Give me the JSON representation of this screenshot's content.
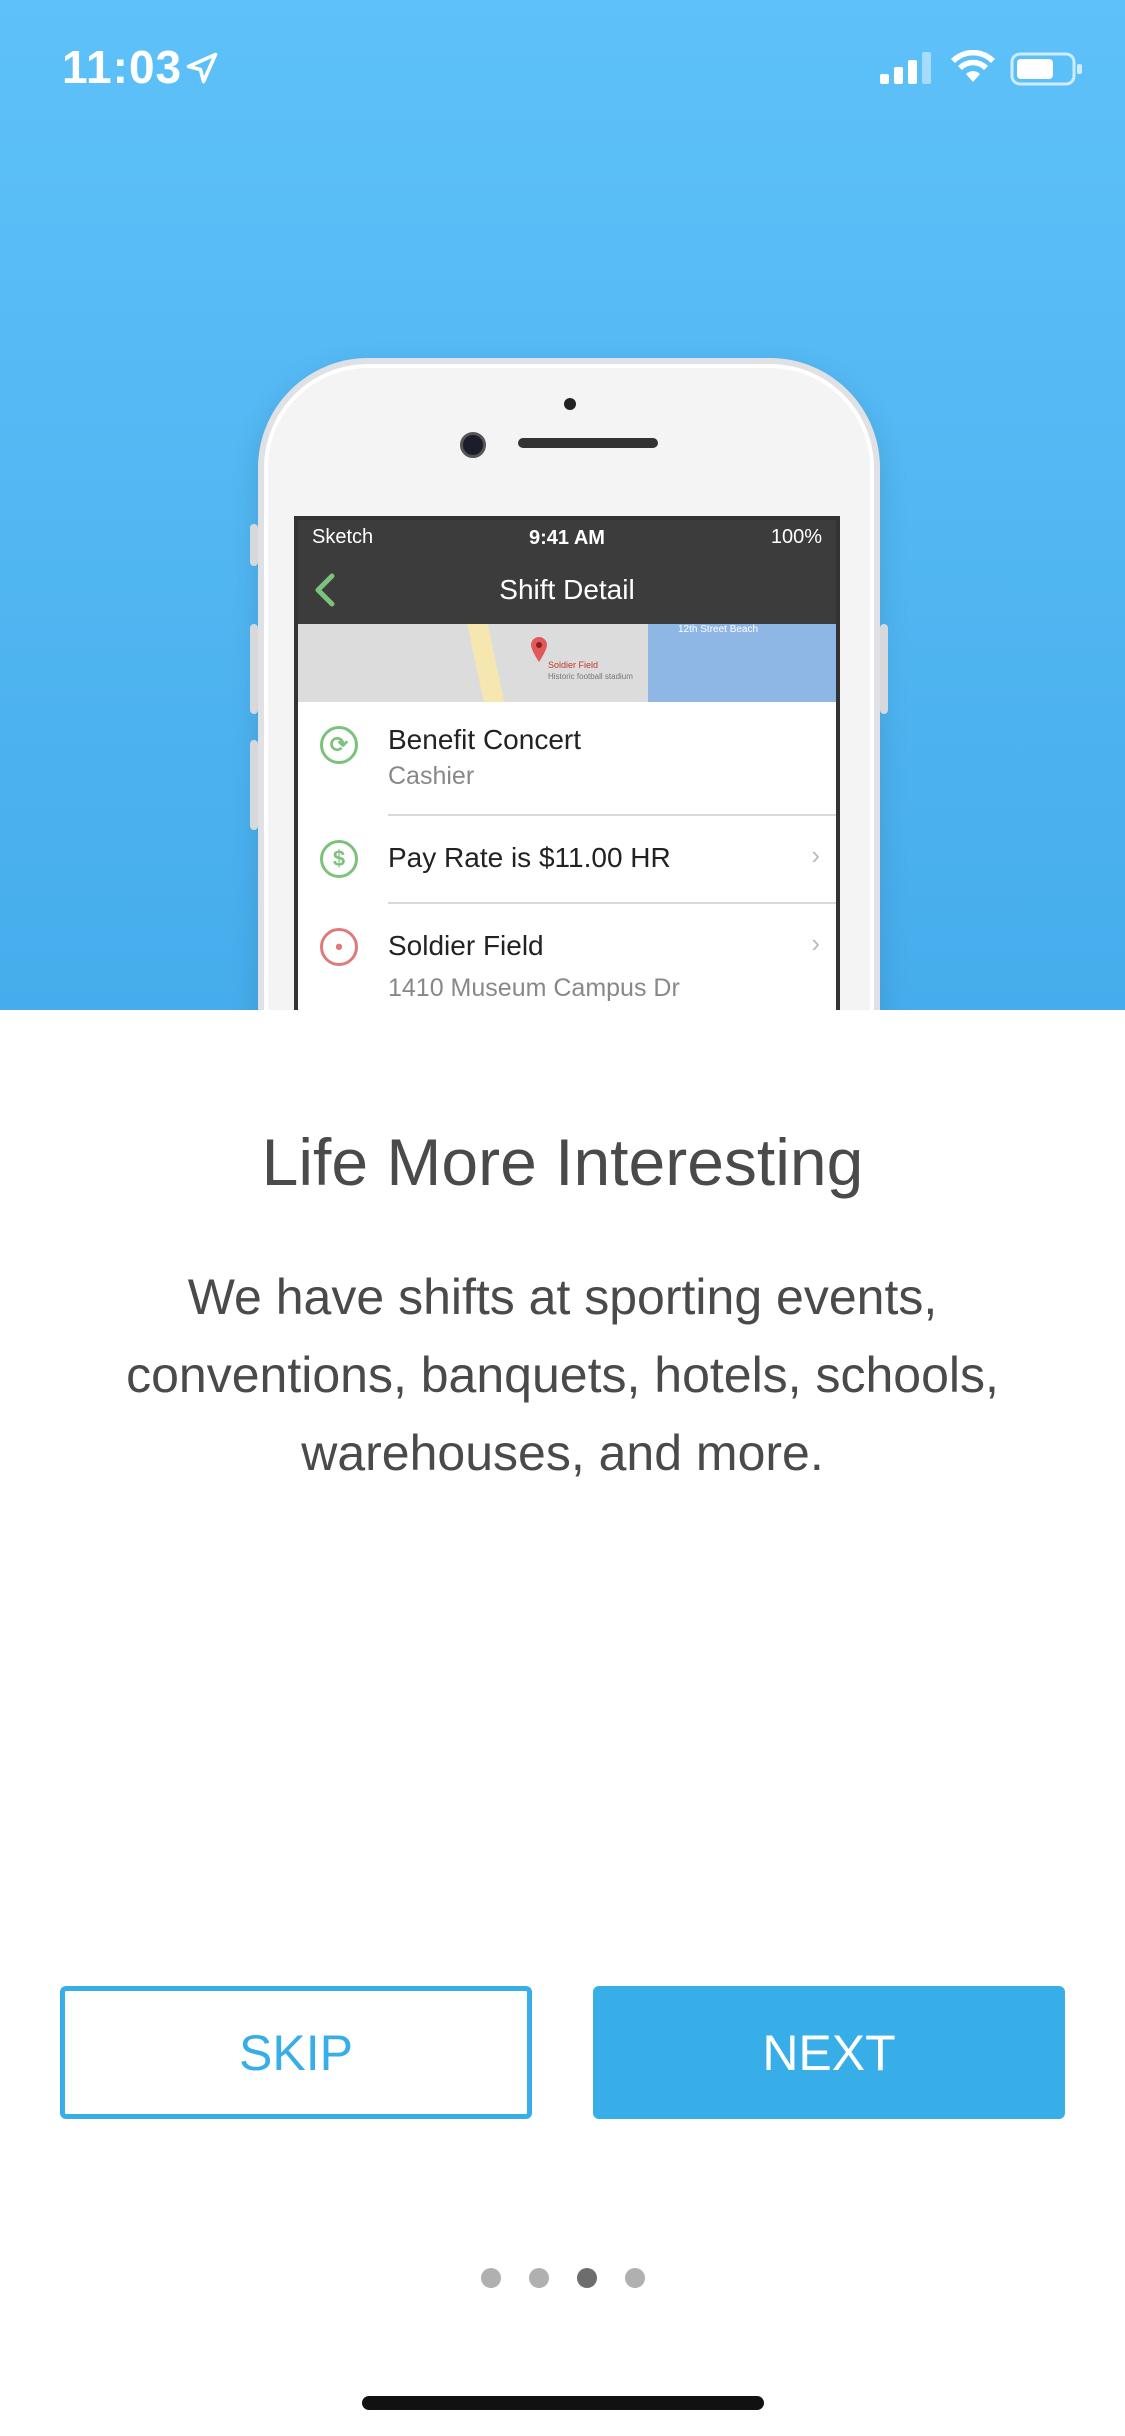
{
  "status_bar": {
    "time": "11:03"
  },
  "illustration": {
    "screen_status": {
      "carrier": "Sketch",
      "time": "9:41 AM",
      "battery": "100%"
    },
    "nav_title": "Shift Detail",
    "map": {
      "place": "Soldier Field",
      "subtitle": "Historic football stadium",
      "beach": "12th Street Beach"
    },
    "rows": [
      {
        "primary": "Benefit Concert",
        "secondary": "Cashier",
        "icon": "event-icon"
      },
      {
        "primary": "Pay Rate is $11.00 HR",
        "icon": "dollar-icon"
      },
      {
        "primary": "Soldier Field",
        "secondary": "1410 Museum Campus Dr",
        "icon": "location-pin-icon"
      }
    ]
  },
  "headline": "Life More Interesting",
  "description": "We have shifts at sporting events, conventions, banquets, hotels, schools, warehouses, and more.",
  "buttons": {
    "skip": "SKIP",
    "next": "NEXT"
  },
  "pagination": {
    "total": 4,
    "current": 3
  },
  "colors": {
    "accent": "#38aee9",
    "hero_top": "#5ec1f9",
    "hero_bottom": "#46adec",
    "text": "#4a4a4a"
  }
}
